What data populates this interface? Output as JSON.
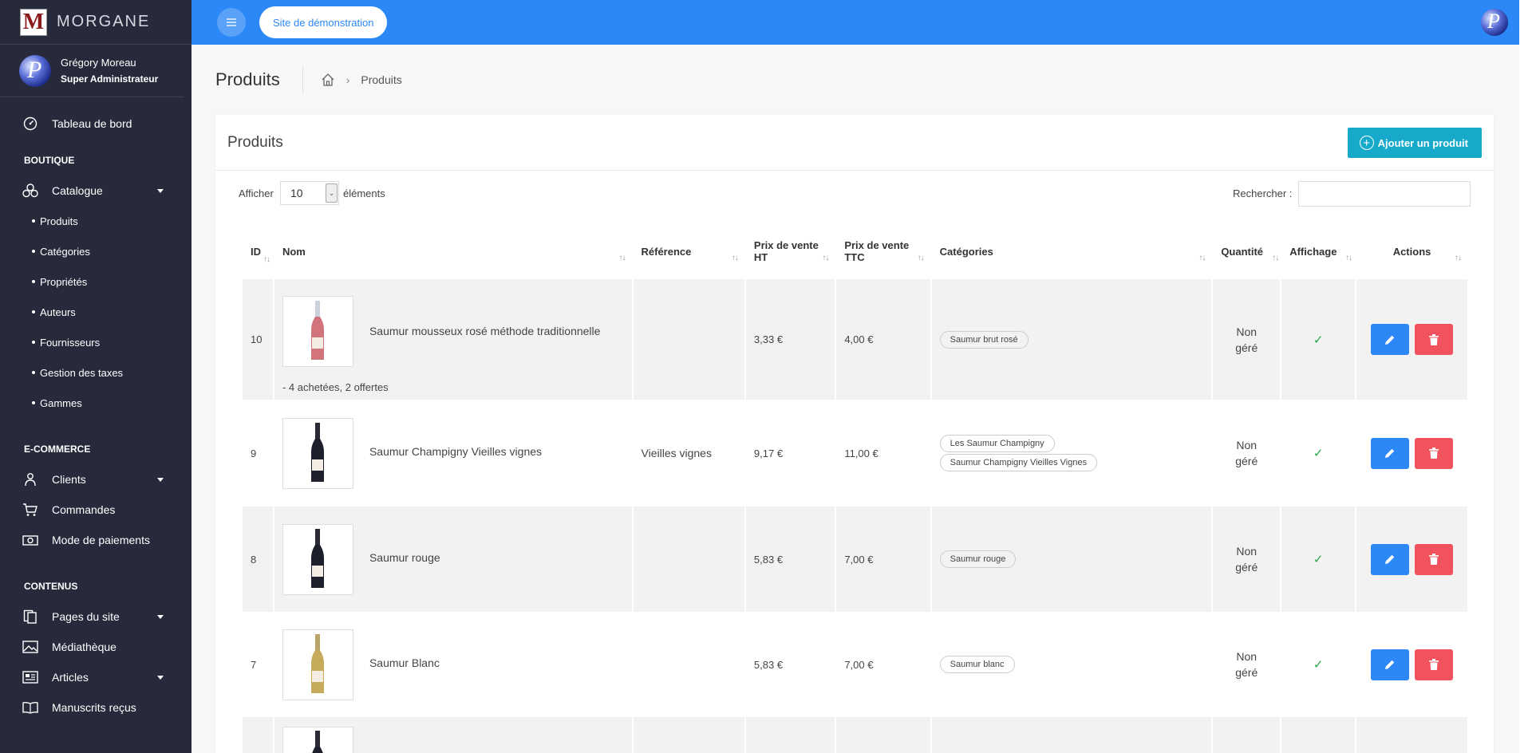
{
  "brand": {
    "logo_letter": "M",
    "name": "MORGANE"
  },
  "user": {
    "name": "Grégory Moreau",
    "role": "Super Administrateur"
  },
  "sidebar": {
    "dashboard": "Tableau de bord",
    "section_boutique": "BOUTIQUE",
    "catalogue": "Catalogue",
    "catalogue_items": [
      "Produits",
      "Catégories",
      "Propriétés",
      "Auteurs",
      "Fournisseurs",
      "Gestion des taxes",
      "Gammes"
    ],
    "section_ecommerce": "E-COMMERCE",
    "clients": "Clients",
    "commandes": "Commandes",
    "paiements": "Mode de paiements",
    "section_contenus": "CONTENUS",
    "pages": "Pages du site",
    "mediatheque": "Médiathèque",
    "articles": "Articles",
    "manuscrits": "Manuscrits reçus"
  },
  "topbar": {
    "site_button": "Site de démonstration"
  },
  "page": {
    "title": "Produits",
    "breadcrumb_current": "Produits"
  },
  "card": {
    "title": "Produits",
    "add_button": "Ajouter un produit"
  },
  "controls": {
    "length_label": "Afficher",
    "length_value": "10",
    "length_after": "éléments",
    "search_label": "Rechercher :"
  },
  "table": {
    "headers": {
      "id": "ID",
      "nom": "Nom",
      "reference": "Référence",
      "prix_ht_1": "Prix de vente",
      "prix_ht_2": "HT",
      "prix_ttc_1": "Prix de vente",
      "prix_ttc_2": "TTC",
      "categories": "Catégories",
      "quantite": "Quantité",
      "affichage": "Affichage",
      "actions": "Actions"
    },
    "rows": [
      {
        "id": "10",
        "name": "Saumur mousseux rosé méthode traditionnelle",
        "extra": "- 4 achetées, 2 offertes",
        "reference": "",
        "ht": "3,33 €",
        "ttc": "4,00 €",
        "cats": [
          "Saumur brut rosé"
        ],
        "qty1": "Non",
        "qty2": "géré",
        "wine": "rose"
      },
      {
        "id": "9",
        "name": "Saumur Champigny Vieilles vignes",
        "extra": "",
        "reference": "Vieilles vignes",
        "ht": "9,17 €",
        "ttc": "11,00 €",
        "cats": [
          "Les Saumur Champigny",
          "Saumur Champigny Vieilles Vignes"
        ],
        "qty1": "Non",
        "qty2": "géré",
        "wine": "red"
      },
      {
        "id": "8",
        "name": "Saumur rouge",
        "extra": "",
        "reference": "",
        "ht": "5,83 €",
        "ttc": "7,00 €",
        "cats": [
          "Saumur rouge"
        ],
        "qty1": "Non",
        "qty2": "géré",
        "wine": "red"
      },
      {
        "id": "7",
        "name": "Saumur Blanc",
        "extra": "",
        "reference": "",
        "ht": "5,83 €",
        "ttc": "7,00 €",
        "cats": [
          "Saumur blanc"
        ],
        "qty1": "Non",
        "qty2": "géré",
        "wine": "white"
      }
    ]
  },
  "colors": {
    "primary": "#2b88f6",
    "sidebar": "#262a3b",
    "add_button": "#17a9c9",
    "danger": "#f0525e",
    "success": "#28a745"
  }
}
